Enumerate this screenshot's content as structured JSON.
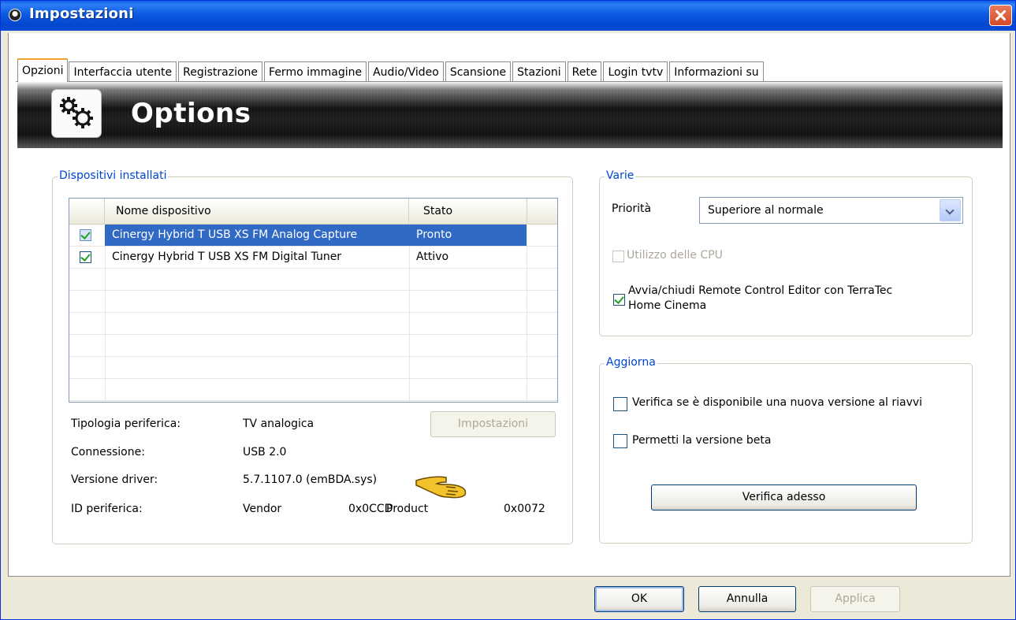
{
  "window": {
    "title": "Impostazioni"
  },
  "tabs": [
    {
      "label": "Opzioni",
      "active": true
    },
    {
      "label": "Interfaccia utente"
    },
    {
      "label": "Registrazione"
    },
    {
      "label": "Fermo immagine"
    },
    {
      "label": "Audio/Video"
    },
    {
      "label": "Scansione"
    },
    {
      "label": "Stazioni"
    },
    {
      "label": "Rete"
    },
    {
      "label": "Login tvtv"
    },
    {
      "label": "Informazioni su"
    }
  ],
  "banner": {
    "title": "Options",
    "icon": "gears-icon"
  },
  "devices": {
    "legend": "Dispositivi installati",
    "columns": [
      "Nome dispositivo",
      "Stato"
    ],
    "rows": [
      {
        "name": "Cinergy Hybrid T USB XS FM Analog Capture",
        "status": "Pronto",
        "checked": true,
        "selected": true
      },
      {
        "name": "Cinergy Hybrid T USB XS FM Digital Tuner",
        "status": "Attivo",
        "checked": true,
        "selected": false
      }
    ],
    "info": {
      "type_label": "Tipologia periferica:",
      "type_value": "TV analogica",
      "conn_label": "Connessione:",
      "conn_value": "USB 2.0",
      "driver_label": "Versione driver:",
      "driver_value": "5.7.1107.0 (emBDA.sys)",
      "id_label": "ID periferica:",
      "vendor_label": "Vendor",
      "vendor_value": "0x0CCD",
      "product_label": "Product",
      "product_value": "0x0072"
    },
    "settings_button": "Impostazioni"
  },
  "varie": {
    "legend": "Varie",
    "priority_label": "Priorità",
    "priority_value": "Superiore al normale",
    "cpu_label": "Utilizzo delle CPU",
    "remote_label_line1": "Avvia/chiudi Remote Control Editor con TerraTec",
    "remote_label_line2": "Home Cinema"
  },
  "aggiorna": {
    "legend": "Aggiorna",
    "check_new_label": "Verifica se è disponibile una nuova versione al riavvi",
    "beta_label": "Permetti la versione beta",
    "check_now_button": "Verifica adesso"
  },
  "footer": {
    "ok": "OK",
    "cancel": "Annulla",
    "apply": "Applica"
  }
}
